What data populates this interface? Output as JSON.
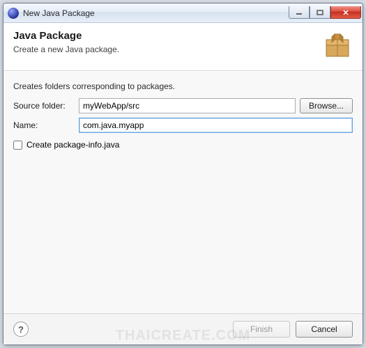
{
  "window": {
    "title": "New Java Package"
  },
  "header": {
    "title": "Java Package",
    "subtitle": "Create a new Java package."
  },
  "content": {
    "hint": "Creates folders corresponding to packages.",
    "sourceFolder": {
      "label": "Source folder:",
      "value": "myWebApp/src",
      "browse": "Browse..."
    },
    "name": {
      "label": "Name:",
      "value": "com.java.myapp"
    },
    "createPackageInfo": {
      "label": "Create package-info.java",
      "checked": false
    }
  },
  "footer": {
    "finish": "Finish",
    "cancel": "Cancel"
  },
  "watermark": "THAICREATE.COM"
}
